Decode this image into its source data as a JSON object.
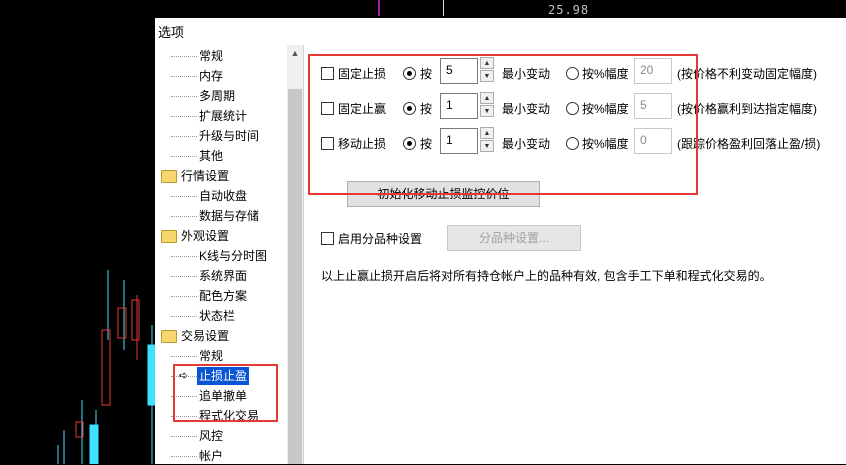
{
  "top": {
    "price": "25.98"
  },
  "dialog": {
    "title": "选项"
  },
  "tree": {
    "items": [
      {
        "label": "常规",
        "level": 2
      },
      {
        "label": "内存",
        "level": 2
      },
      {
        "label": "多周期",
        "level": 2
      },
      {
        "label": "扩展统计",
        "level": 2
      },
      {
        "label": "升级与时间",
        "level": 2
      },
      {
        "label": "其他",
        "level": 2
      },
      {
        "label": "行情设置",
        "level": 1
      },
      {
        "label": "自动收盘",
        "level": 2
      },
      {
        "label": "数据与存储",
        "level": 2
      },
      {
        "label": "外观设置",
        "level": 1
      },
      {
        "label": "K线与分时图",
        "level": 2
      },
      {
        "label": "系统界面",
        "level": 2
      },
      {
        "label": "配色方案",
        "level": 2
      },
      {
        "label": "状态栏",
        "level": 2
      },
      {
        "label": "交易设置",
        "level": 1
      },
      {
        "label": "常规",
        "level": 2
      },
      {
        "label": "止损止盈",
        "level": 2,
        "selected": true
      },
      {
        "label": "追单撤单",
        "level": 2
      },
      {
        "label": "程式化交易",
        "level": 2
      },
      {
        "label": "风控",
        "level": 2
      },
      {
        "label": "帐户",
        "level": 2
      }
    ]
  },
  "rows": [
    {
      "check_label": "固定止损",
      "by_label": "按",
      "value": "5",
      "min_label": "最小变动",
      "pct_label": "按%幅度",
      "pct_value": "20",
      "desc": "(按价格不利变动固定幅度)"
    },
    {
      "check_label": "固定止赢",
      "by_label": "按",
      "value": "1",
      "min_label": "最小变动",
      "pct_label": "按%幅度",
      "pct_value": "5",
      "desc": "(按价格赢利到达指定幅度)"
    },
    {
      "check_label": "移动止损",
      "by_label": "按",
      "value": "1",
      "min_label": "最小变动",
      "pct_label": "按%幅度",
      "pct_value": "0",
      "desc": "(跟踪价格盈利回落止盈/损)"
    }
  ],
  "buttons": {
    "init_label": "初始化移动止损监控价位",
    "split_label": "分品种设置..."
  },
  "split": {
    "check_label": "启用分品种设置"
  },
  "note": "以上止赢止损开启后将对所有持仓帐户上的品种有效, 包含手工下单和程式化交易的。",
  "colors": {
    "highlight": "#e53935",
    "selection": "#0a54d6",
    "bull": "#e53935",
    "bear": "#40e0ff"
  }
}
